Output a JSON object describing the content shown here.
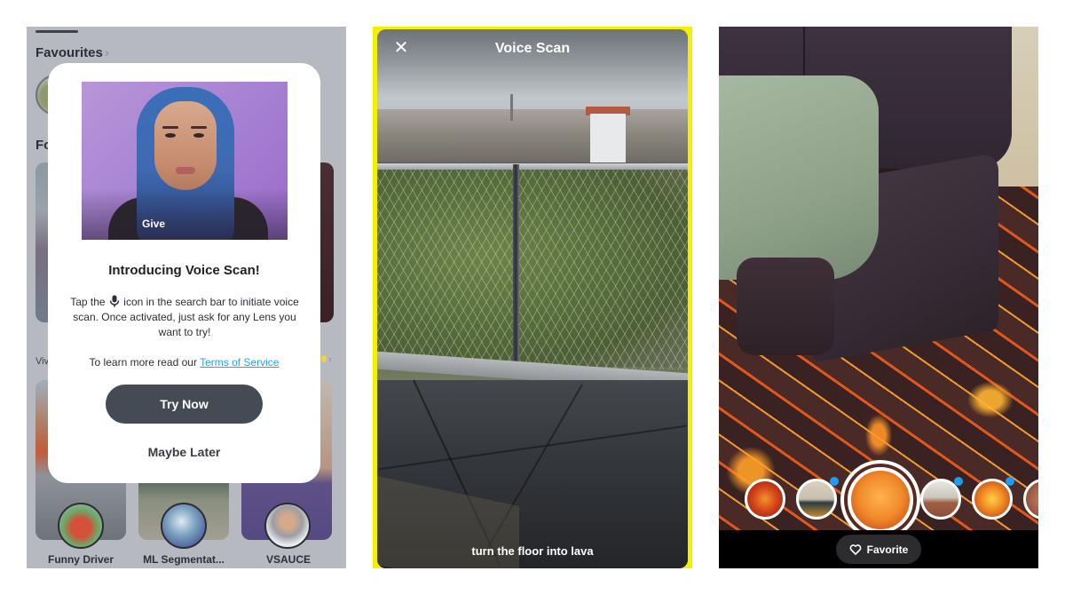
{
  "panel1": {
    "favourites_title": "Favourites",
    "favourites_chevron": "›",
    "for_you_title_partial": "Fo",
    "vivid_partial": "Viv",
    "section_chevron": "›",
    "lenses": [
      {
        "name": "Funny Driver"
      },
      {
        "name": "ML Segmentat..."
      },
      {
        "name": "VSAUCE"
      }
    ],
    "modal": {
      "video_caption": "Give",
      "title": "Introducing Voice Scan!",
      "body_before_icon": "Tap the",
      "body_icon": "microphone-icon",
      "body_after_icon": "icon in the search bar to initiate voice scan. Once activated, just ask for any Lens you want to try!",
      "terms_prefix": "To learn more read our",
      "terms_link": "Terms of Service",
      "primary_button": "Try Now",
      "secondary_button": "Maybe Later"
    }
  },
  "panel2": {
    "title": "Voice Scan",
    "close_icon": "close-icon",
    "close_glyph": "✕",
    "caption": "turn the floor into lava",
    "frame_color": "#f5f000"
  },
  "panel3": {
    "favorite_label": "Favorite",
    "favorite_icon": "heart-outline-icon",
    "carousel": [
      {
        "name": "lava-lens-1",
        "new": false,
        "selected": false
      },
      {
        "name": "lava-lens-2",
        "new": true,
        "selected": false
      },
      {
        "name": "lava-lens-3",
        "new": false,
        "selected": true
      },
      {
        "name": "lava-lens-4",
        "new": true,
        "selected": false
      },
      {
        "name": "lava-lens-5",
        "new": true,
        "selected": false
      },
      {
        "name": "lava-lens-6",
        "new": false,
        "selected": false
      }
    ],
    "badge_color": "#1e9cf2"
  },
  "colors": {
    "accent_link": "#2ba2e8",
    "primary_button_bg": "#444b54",
    "background_gray": "#b6b9bf"
  }
}
